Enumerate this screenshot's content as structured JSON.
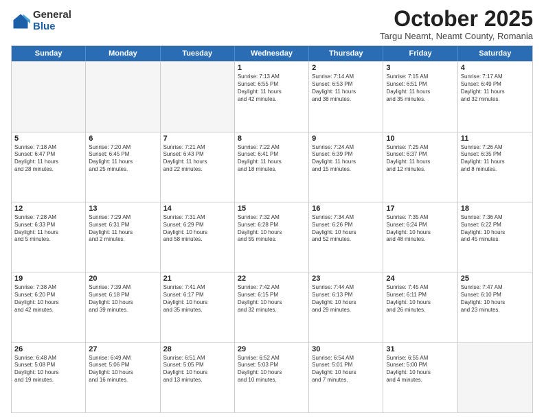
{
  "logo": {
    "general": "General",
    "blue": "Blue"
  },
  "header": {
    "month": "October 2025",
    "location": "Targu Neamt, Neamt County, Romania"
  },
  "days": [
    "Sunday",
    "Monday",
    "Tuesday",
    "Wednesday",
    "Thursday",
    "Friday",
    "Saturday"
  ],
  "weeks": [
    [
      {
        "day": "",
        "text": ""
      },
      {
        "day": "",
        "text": ""
      },
      {
        "day": "",
        "text": ""
      },
      {
        "day": "1",
        "text": "Sunrise: 7:13 AM\nSunset: 6:55 PM\nDaylight: 11 hours\nand 42 minutes."
      },
      {
        "day": "2",
        "text": "Sunrise: 7:14 AM\nSunset: 6:53 PM\nDaylight: 11 hours\nand 38 minutes."
      },
      {
        "day": "3",
        "text": "Sunrise: 7:15 AM\nSunset: 6:51 PM\nDaylight: 11 hours\nand 35 minutes."
      },
      {
        "day": "4",
        "text": "Sunrise: 7:17 AM\nSunset: 6:49 PM\nDaylight: 11 hours\nand 32 minutes."
      }
    ],
    [
      {
        "day": "5",
        "text": "Sunrise: 7:18 AM\nSunset: 6:47 PM\nDaylight: 11 hours\nand 28 minutes."
      },
      {
        "day": "6",
        "text": "Sunrise: 7:20 AM\nSunset: 6:45 PM\nDaylight: 11 hours\nand 25 minutes."
      },
      {
        "day": "7",
        "text": "Sunrise: 7:21 AM\nSunset: 6:43 PM\nDaylight: 11 hours\nand 22 minutes."
      },
      {
        "day": "8",
        "text": "Sunrise: 7:22 AM\nSunset: 6:41 PM\nDaylight: 11 hours\nand 18 minutes."
      },
      {
        "day": "9",
        "text": "Sunrise: 7:24 AM\nSunset: 6:39 PM\nDaylight: 11 hours\nand 15 minutes."
      },
      {
        "day": "10",
        "text": "Sunrise: 7:25 AM\nSunset: 6:37 PM\nDaylight: 11 hours\nand 12 minutes."
      },
      {
        "day": "11",
        "text": "Sunrise: 7:26 AM\nSunset: 6:35 PM\nDaylight: 11 hours\nand 8 minutes."
      }
    ],
    [
      {
        "day": "12",
        "text": "Sunrise: 7:28 AM\nSunset: 6:33 PM\nDaylight: 11 hours\nand 5 minutes."
      },
      {
        "day": "13",
        "text": "Sunrise: 7:29 AM\nSunset: 6:31 PM\nDaylight: 11 hours\nand 2 minutes."
      },
      {
        "day": "14",
        "text": "Sunrise: 7:31 AM\nSunset: 6:29 PM\nDaylight: 10 hours\nand 58 minutes."
      },
      {
        "day": "15",
        "text": "Sunrise: 7:32 AM\nSunset: 6:28 PM\nDaylight: 10 hours\nand 55 minutes."
      },
      {
        "day": "16",
        "text": "Sunrise: 7:34 AM\nSunset: 6:26 PM\nDaylight: 10 hours\nand 52 minutes."
      },
      {
        "day": "17",
        "text": "Sunrise: 7:35 AM\nSunset: 6:24 PM\nDaylight: 10 hours\nand 48 minutes."
      },
      {
        "day": "18",
        "text": "Sunrise: 7:36 AM\nSunset: 6:22 PM\nDaylight: 10 hours\nand 45 minutes."
      }
    ],
    [
      {
        "day": "19",
        "text": "Sunrise: 7:38 AM\nSunset: 6:20 PM\nDaylight: 10 hours\nand 42 minutes."
      },
      {
        "day": "20",
        "text": "Sunrise: 7:39 AM\nSunset: 6:18 PM\nDaylight: 10 hours\nand 39 minutes."
      },
      {
        "day": "21",
        "text": "Sunrise: 7:41 AM\nSunset: 6:17 PM\nDaylight: 10 hours\nand 35 minutes."
      },
      {
        "day": "22",
        "text": "Sunrise: 7:42 AM\nSunset: 6:15 PM\nDaylight: 10 hours\nand 32 minutes."
      },
      {
        "day": "23",
        "text": "Sunrise: 7:44 AM\nSunset: 6:13 PM\nDaylight: 10 hours\nand 29 minutes."
      },
      {
        "day": "24",
        "text": "Sunrise: 7:45 AM\nSunset: 6:11 PM\nDaylight: 10 hours\nand 26 minutes."
      },
      {
        "day": "25",
        "text": "Sunrise: 7:47 AM\nSunset: 6:10 PM\nDaylight: 10 hours\nand 23 minutes."
      }
    ],
    [
      {
        "day": "26",
        "text": "Sunrise: 6:48 AM\nSunset: 5:08 PM\nDaylight: 10 hours\nand 19 minutes."
      },
      {
        "day": "27",
        "text": "Sunrise: 6:49 AM\nSunset: 5:06 PM\nDaylight: 10 hours\nand 16 minutes."
      },
      {
        "day": "28",
        "text": "Sunrise: 6:51 AM\nSunset: 5:05 PM\nDaylight: 10 hours\nand 13 minutes."
      },
      {
        "day": "29",
        "text": "Sunrise: 6:52 AM\nSunset: 5:03 PM\nDaylight: 10 hours\nand 10 minutes."
      },
      {
        "day": "30",
        "text": "Sunrise: 6:54 AM\nSunset: 5:01 PM\nDaylight: 10 hours\nand 7 minutes."
      },
      {
        "day": "31",
        "text": "Sunrise: 6:55 AM\nSunset: 5:00 PM\nDaylight: 10 hours\nand 4 minutes."
      },
      {
        "day": "",
        "text": ""
      }
    ]
  ]
}
